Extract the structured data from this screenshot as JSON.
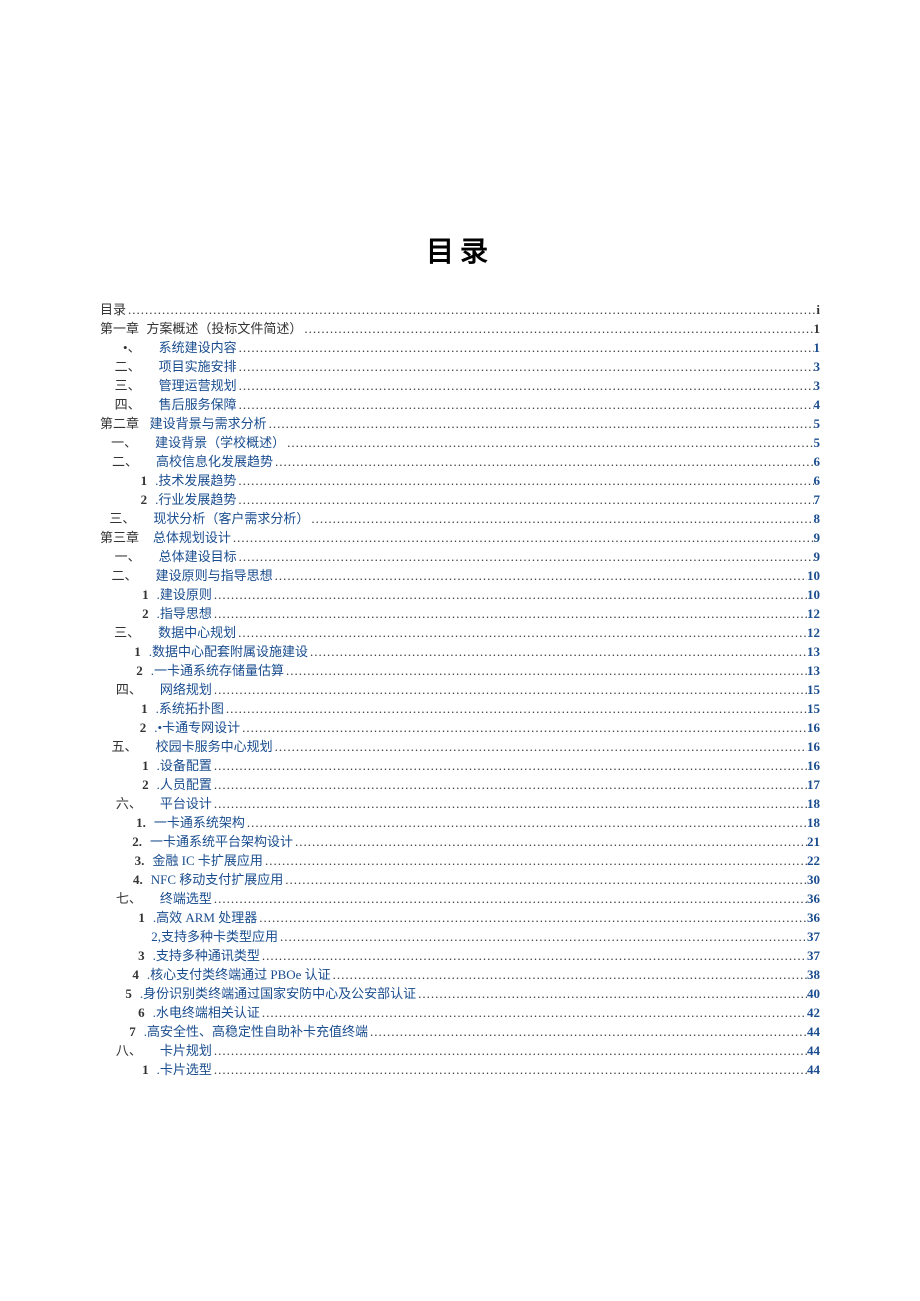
{
  "title": "目录",
  "dots_fill": "..............................................................................................................................................................................................................",
  "entries": [
    {
      "level": 0,
      "label": "目录",
      "text": "",
      "page": "i",
      "link": false,
      "inline_label": true
    },
    {
      "level": 0,
      "label": "第一章",
      "text": "方案概述（投标文件简述）",
      "page": "1",
      "link": false
    },
    {
      "level": 1,
      "label": "•、",
      "text": "系统建设内容",
      "page": "1",
      "link": true
    },
    {
      "level": 1,
      "label": "二、",
      "text": "项目实施安排",
      "page": "3",
      "link": true
    },
    {
      "level": 1,
      "label": "三、",
      "text": "管理运营规划",
      "page": "3",
      "link": true
    },
    {
      "level": 1,
      "label": "四、",
      "text": "售后服务保障",
      "page": "4",
      "link": true
    },
    {
      "level": 0,
      "label": "第二章",
      "text": "建设背景与需求分析",
      "page": "5",
      "link": true
    },
    {
      "level": 1,
      "label": "一、",
      "text": "建设背景（学校概述）",
      "page": "5",
      "link": true
    },
    {
      "level": 1,
      "label": "二、",
      "text": "高校信息化发展趋势",
      "page": "6",
      "link": true
    },
    {
      "level": 2,
      "label": "1",
      "text": ".技术发展趋势",
      "page": "6",
      "link": true
    },
    {
      "level": 2,
      "label": "2",
      "text": ".行业发展趋势",
      "page": "7",
      "link": true
    },
    {
      "level": 1,
      "label": "三、",
      "text": "现状分析（客户需求分析）",
      "page": "8",
      "link": true
    },
    {
      "level": 0,
      "label": "第三章",
      "text": "总体规划设计",
      "page": "9",
      "link": true
    },
    {
      "level": 1,
      "label": "一、",
      "text": "总体建设目标",
      "page": "9",
      "link": true
    },
    {
      "level": 1,
      "label": "二、",
      "text": "建设原则与指导思想",
      "page": "10",
      "link": true
    },
    {
      "level": 2,
      "label": "1",
      "text": ".建设原则",
      "page": "10",
      "link": true
    },
    {
      "level": 2,
      "label": "2",
      "text": ".指导思想",
      "page": "12",
      "link": true
    },
    {
      "level": 1,
      "label": "三、",
      "text": "数据中心规划",
      "page": "12",
      "link": true
    },
    {
      "level": 2,
      "label": "1",
      "text": ".数据中心配套附属设施建设",
      "page": "13",
      "link": true
    },
    {
      "level": 2,
      "label": "2",
      "text": ".一卡通系统存储量估算",
      "page": "13",
      "link": true
    },
    {
      "level": 1,
      "label": "四、",
      "text": "网络规划",
      "page": "15",
      "link": true
    },
    {
      "level": 2,
      "label": "1",
      "text": ".系统拓扑图",
      "page": "15",
      "link": true
    },
    {
      "level": 2,
      "label": "2",
      "text": ".•卡通专网设计",
      "page": "16",
      "link": true
    },
    {
      "level": 1,
      "label": "五、",
      "text": "校园卡服务中心规划",
      "page": "16",
      "link": true
    },
    {
      "level": 2,
      "label": "1",
      "text": ".设备配置",
      "page": "16",
      "link": true
    },
    {
      "level": 2,
      "label": "2",
      "text": ".人员配置",
      "page": "17",
      "link": true
    },
    {
      "level": 1,
      "label": "六、",
      "text": "平台设计",
      "page": "18",
      "link": true
    },
    {
      "level": 2,
      "label": "1.",
      "text": "一卡通系统架构",
      "page": "18",
      "link": true
    },
    {
      "level": 2,
      "label": "2.",
      "text": "一卡通系统平台架构设计",
      "page": "21",
      "link": true
    },
    {
      "level": 2,
      "label": "3.",
      "text": "金融 IC 卡扩展应用",
      "page": "22",
      "link": true
    },
    {
      "level": 2,
      "label": "4.",
      "text": "NFC 移动支付扩展应用",
      "page": "30",
      "link": true
    },
    {
      "level": 1,
      "label": "七、",
      "text": "终端选型",
      "page": "36",
      "link": true
    },
    {
      "level": 2,
      "label": "1",
      "text": ".高效 ARM 处理器",
      "page": "36",
      "link": true
    },
    {
      "level": 2,
      "label": "",
      "text": "2,支持多种卡类型应用",
      "page": "37",
      "link": true,
      "raw": true
    },
    {
      "level": 2,
      "label": "3",
      "text": ".支持多种通讯类型",
      "page": "37",
      "link": true
    },
    {
      "level": 2,
      "label": "4",
      "text": ".核心支付类终端通过 PBOe 认证",
      "page": "38",
      "link": true
    },
    {
      "level": 2,
      "label": "5",
      "text": ".身份识别类终端通过国家安防中心及公安部认证",
      "page": "40",
      "link": true
    },
    {
      "level": 2,
      "label": "6",
      "text": ".水电终端相关认证",
      "page": "42",
      "link": true
    },
    {
      "level": 2,
      "label": "7",
      "text": ".高安全性、高稳定性自助补卡充值终端",
      "page": "44",
      "link": true
    },
    {
      "level": 1,
      "label": "八、",
      "text": "卡片规划",
      "page": "44",
      "link": true
    },
    {
      "level": 2,
      "label": "1",
      "text": ".卡片选型",
      "page": "44",
      "link": true
    }
  ]
}
